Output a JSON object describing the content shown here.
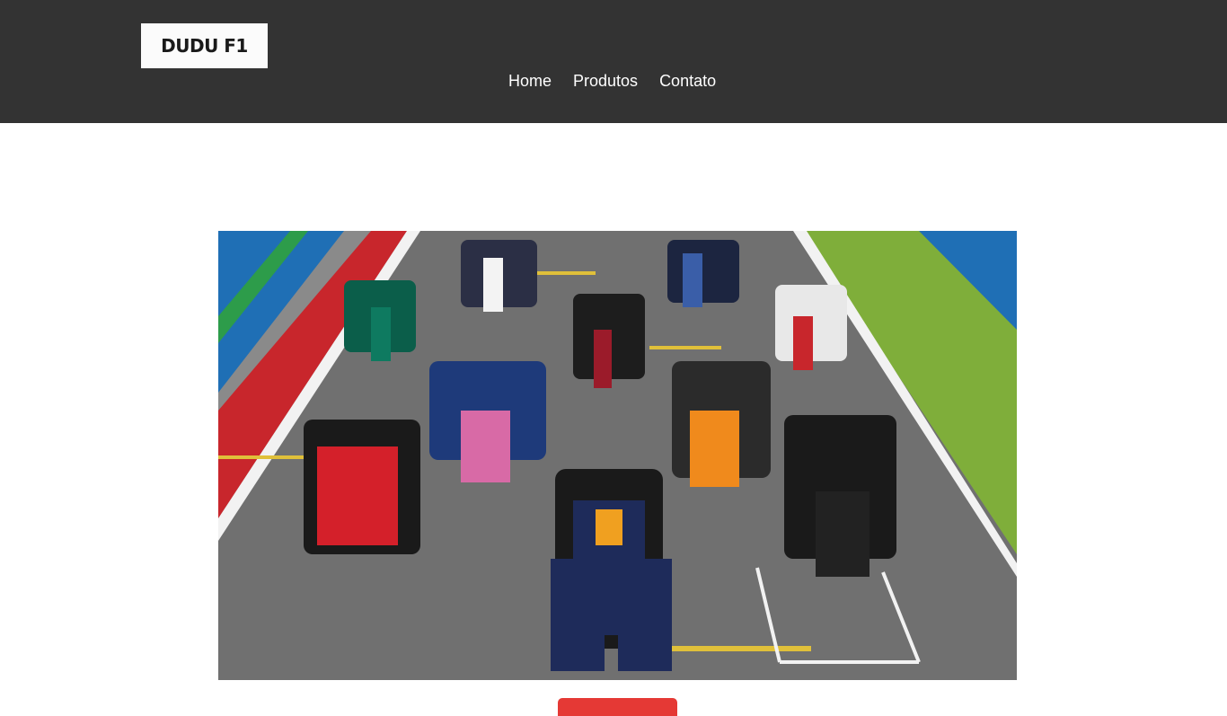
{
  "header": {
    "logo_text": "DUDU F1",
    "nav": [
      {
        "label": "Home"
      },
      {
        "label": "Produtos"
      },
      {
        "label": "Contato"
      }
    ]
  },
  "hero": {
    "image_subject": "f1-grid-photo",
    "colors": {
      "asphalt": "#6f6f6f",
      "grass": "#7fae3a",
      "kerb_red": "#c8262c",
      "barrier_blue": "#1f6fb5"
    }
  },
  "cta": {
    "label": "",
    "color": "#e53935"
  }
}
